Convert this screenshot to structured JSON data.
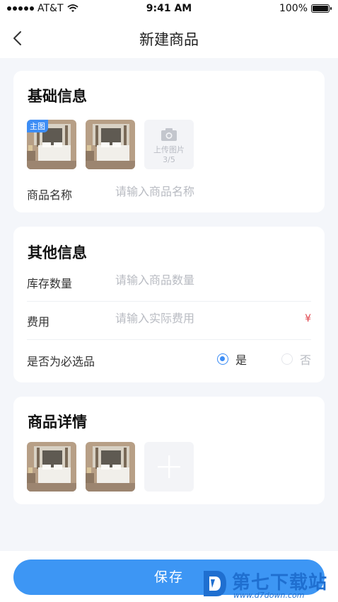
{
  "status_bar": {
    "carrier": "AT&T",
    "time": "9:41 AM",
    "battery": "100%",
    "battery_level": 1.0
  },
  "nav": {
    "title": "新建商品"
  },
  "basic_info": {
    "title": "基础信息",
    "main_tag": "主图",
    "upload_label": "上传图片",
    "upload_count": "3/5",
    "name_label": "商品名称",
    "name_placeholder": "请输入商品名称"
  },
  "other_info": {
    "title": "其他信息",
    "stock_label": "库存数量",
    "stock_placeholder": "请输入商品数量",
    "fee_label": "费用",
    "fee_placeholder": "请输入实际费用",
    "currency_symbol": "¥",
    "required_label": "是否为必选品",
    "option_yes": "是",
    "option_no": "否",
    "selected": "是"
  },
  "detail": {
    "title": "商品详情"
  },
  "footer": {
    "save_label": "保存"
  },
  "watermark": {
    "title": "第七下载站",
    "url": "www.d7down.com"
  },
  "colors": {
    "accent": "#3d96f4",
    "currency": "#e0434b",
    "background": "#f4f6fa"
  }
}
